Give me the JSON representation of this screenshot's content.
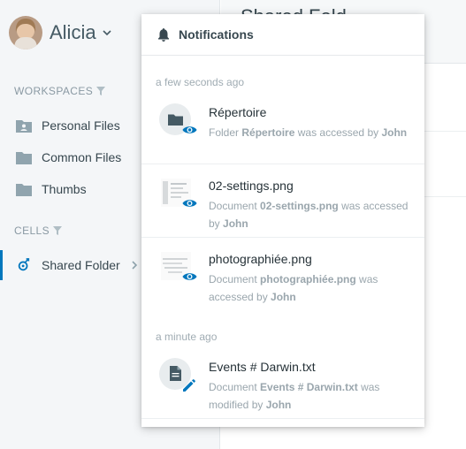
{
  "user": {
    "name": "Alicia"
  },
  "sidebar": {
    "workspaces_label": "WORKSPACES",
    "workspaces": [
      {
        "label": "Personal Files",
        "icon": "person-folder-icon"
      },
      {
        "label": "Common Files",
        "icon": "folder-icon"
      },
      {
        "label": "Thumbs",
        "icon": "folder-icon"
      }
    ],
    "cells_label": "CELLS",
    "cells": [
      {
        "label": "Shared Folder",
        "icon": "shared-cell-icon"
      }
    ]
  },
  "main": {
    "title": "Shared Fold"
  },
  "notifications": {
    "title": "Notifications",
    "groups": [
      {
        "label": "a few seconds ago",
        "items": [
          {
            "name": "Répertoire",
            "kind": "Folder",
            "target": "Répertoire",
            "action": "was accessed by",
            "user": "John",
            "badge": "eye-icon"
          },
          {
            "name": "02-settings.png",
            "kind": "Document",
            "target": "02-settings.png",
            "action": "was accessed by",
            "user": "John",
            "badge": "eye-icon"
          },
          {
            "name": "photographiée.png",
            "kind": "Document",
            "target": "photographiée.png",
            "action": "was accessed by",
            "user": "John",
            "badge": "eye-icon"
          }
        ]
      },
      {
        "label": "a minute ago",
        "items": [
          {
            "name": "Events # Darwin.txt",
            "kind": "Document",
            "target": "Events # Darwin.txt",
            "action": "was modified by",
            "user": "John",
            "badge": "pencil-icon"
          }
        ]
      }
    ]
  },
  "colors": {
    "accent": "#0277bd",
    "sidebar_bg": "#f4f6f8",
    "text": "#37474f"
  }
}
